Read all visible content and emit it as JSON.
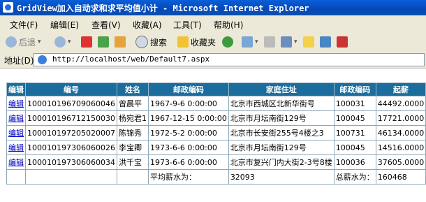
{
  "window": {
    "title": "GridView加入自动求和求平均值小计 - Microsoft Internet Explorer"
  },
  "menu": {
    "items": [
      "文件(F)",
      "编辑(E)",
      "查看(V)",
      "收藏(A)",
      "工具(T)",
      "帮助(H)"
    ]
  },
  "toolbar": {
    "back_label": "后退",
    "search_label": "搜索",
    "favorites_label": "收藏夹"
  },
  "address": {
    "label": "地址(D)",
    "url": "http://localhost/web/Default7.aspx"
  },
  "grid": {
    "headers": [
      "编辑",
      "编号",
      "姓名",
      "邮政编码",
      "家庭住址",
      "邮政编码",
      "起薪"
    ],
    "rows": [
      {
        "edit": "编辑",
        "id": "100010196709060046",
        "name": "曾晨平",
        "birth": "1967-9-6 0:00:00",
        "address": "北京市西城区北新华街号",
        "zip": "100031",
        "salary": "44492.0000"
      },
      {
        "edit": "编辑",
        "id": "100010196712150030",
        "name": "杨宛君1",
        "birth": "1967-12-15 0:00:00",
        "address": "北京市月坛南街129号",
        "zip": "100045",
        "salary": "17721.0000"
      },
      {
        "edit": "编辑",
        "id": "100010197205020007",
        "name": "陈锦秀",
        "birth": "1972-5-2 0:00:00",
        "address": "北京市长安街255号4楼之3",
        "zip": "100731",
        "salary": "46134.0000"
      },
      {
        "edit": "编辑",
        "id": "100010197306060026",
        "name": "李宝卿",
        "birth": "1973-6-6 0:00:00",
        "address": "北京市月坛南街129号",
        "zip": "100045",
        "salary": "14516.0000"
      },
      {
        "edit": "编辑",
        "id": "100010197306060034",
        "name": "洪千宝",
        "birth": "1973-6-6 0:00:00",
        "address": "北京市复兴门内大街2-3号8楼",
        "zip": "100036",
        "salary": "37605.0000"
      }
    ],
    "footer": {
      "avg_label": "平均薪水为：",
      "avg_value": "32093",
      "total_label": "总薪水为：",
      "total_value": "160468"
    }
  }
}
